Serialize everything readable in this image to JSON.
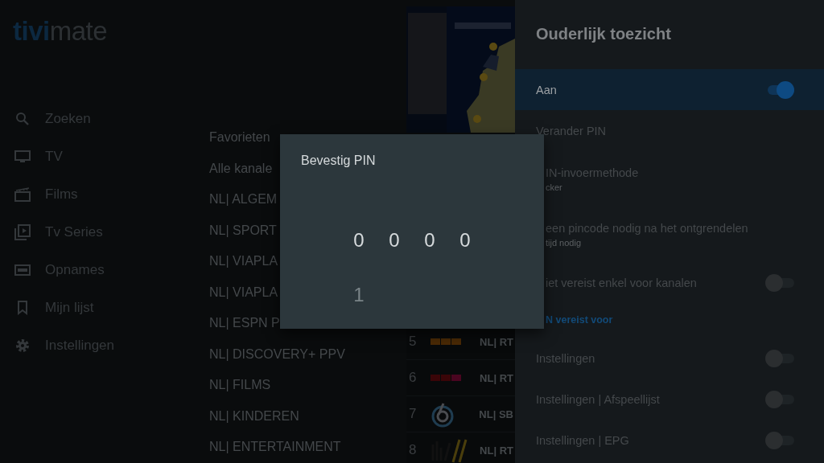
{
  "logo": {
    "accent": "tivi",
    "rest": "mate"
  },
  "sidebar": {
    "items": [
      {
        "label": "Zoeken",
        "selected": false
      },
      {
        "label": "TV",
        "selected": false
      },
      {
        "label": "Films",
        "selected": false
      },
      {
        "label": "Tv Series",
        "selected": false
      },
      {
        "label": "Opnames",
        "selected": false
      },
      {
        "label": "Mijn lijst",
        "selected": false
      },
      {
        "label": "Instellingen",
        "selected": false
      }
    ]
  },
  "categories": [
    {
      "label": "Favorieten",
      "selected": false
    },
    {
      "label": "Alle kanale",
      "selected": false
    },
    {
      "label": "NL| ALGEM",
      "selected": false
    },
    {
      "label": "NL| SPORT",
      "selected": false
    },
    {
      "label": "NL| VIAPLA",
      "selected": false
    },
    {
      "label": "NL| VIAPLA",
      "selected": false
    },
    {
      "label": "NL| ESPN P",
      "selected": false
    },
    {
      "label": "NL| DISCOVERY+ PPV",
      "selected": false
    },
    {
      "label": "NL| FILMS",
      "selected": false
    },
    {
      "label": "NL| KINDEREN",
      "selected": false
    },
    {
      "label": "NL| ENTERTAINMENT",
      "selected": false
    }
  ],
  "channels": [
    {
      "number": "5",
      "name": "NL| RT",
      "kind": "rtl4"
    },
    {
      "number": "6",
      "name": "NL| RT",
      "kind": "rtl5"
    },
    {
      "number": "7",
      "name": "NL| SB",
      "kind": "sbs6"
    },
    {
      "number": "8",
      "name": "NL| RT",
      "kind": "rtl7"
    }
  ],
  "settings": {
    "title": "Ouderlijk toezicht",
    "items": [
      {
        "kind": "toggle",
        "label": "Aan",
        "on": true,
        "selected": true,
        "covered": false
      },
      {
        "kind": "text",
        "label": "Verander PIN",
        "selected": false,
        "covered": false
      },
      {
        "kind": "text",
        "label": "IN-invoermethode",
        "sublabel": "cker",
        "selected": false,
        "covered": true
      },
      {
        "kind": "text",
        "label": "een pincode nodig na het ontgrendelen",
        "sublabel": "tijd nodig",
        "selected": false,
        "covered": true
      },
      {
        "kind": "toggle",
        "label": "iet vereist enkel voor kanalen",
        "on": false,
        "selected": false,
        "covered": true
      },
      {
        "kind": "header",
        "label": "N vereist voor",
        "selected": false,
        "covered": true
      },
      {
        "kind": "toggle",
        "label": "Instellingen",
        "on": false,
        "selected": false,
        "covered": false
      },
      {
        "kind": "toggle",
        "label": "Instellingen | Afspeellijst",
        "on": false,
        "selected": false,
        "covered": false
      },
      {
        "kind": "toggle",
        "label": "Instellingen | EPG",
        "on": false,
        "selected": false,
        "covered": false
      }
    ]
  },
  "dialog": {
    "title": "Bevestig PIN",
    "digits": [
      "0",
      "0",
      "0",
      "0"
    ],
    "next_digits": [
      "1"
    ]
  }
}
